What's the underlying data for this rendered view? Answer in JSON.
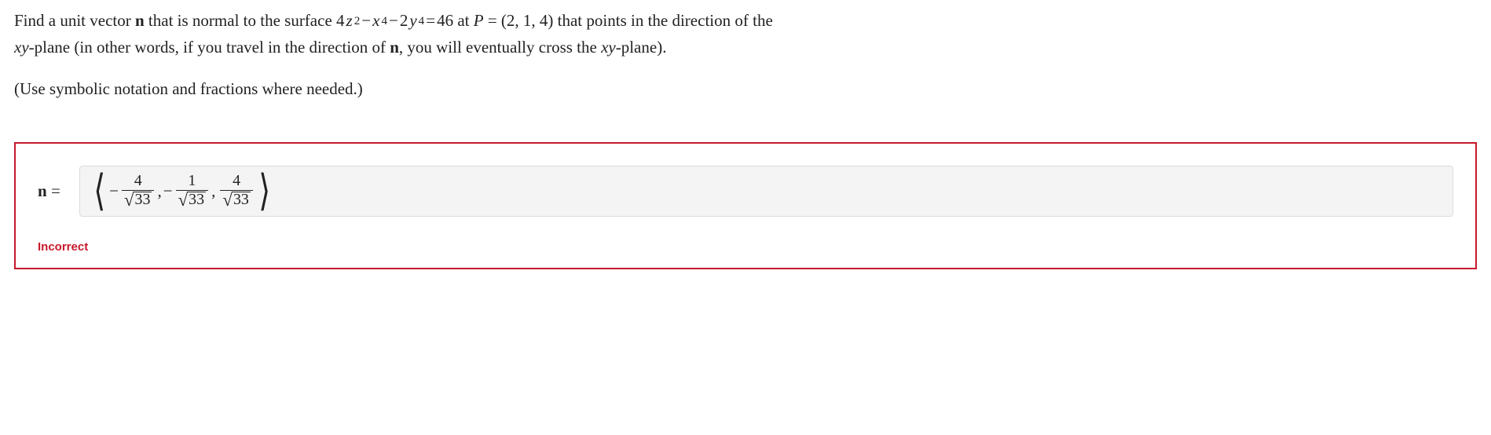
{
  "problem": {
    "line1_pre": "Find a unit vector ",
    "vector_symbol": "n",
    "line1_mid1": " that is normal to the surface ",
    "equation_lhs_parts": {
      "term1_coef": "4",
      "term1_var": "z",
      "term1_exp": "2",
      "minus1": " − ",
      "term2_var": "x",
      "term2_exp": "4",
      "minus2": " − ",
      "term3_coef": "2",
      "term3_var": "y",
      "term3_exp": "4"
    },
    "equals": " = ",
    "rhs": "46",
    "line1_mid2": " at ",
    "point_label": "P",
    "point_eq": " = ",
    "point_value": "(2, 1, 4)",
    "line1_tail": " that points in the direction of the",
    "line2_pre_var": "xy",
    "line2_mid": "-plane (in other words, if you travel in the direction of ",
    "line2_post": ", you will eventually cross the ",
    "line2_var2": "xy",
    "line2_end": "-plane).",
    "instruction": "(Use symbolic notation and fractions where needed.)"
  },
  "answer": {
    "label_symbol": "n",
    "label_eq": " =",
    "vec_open": "⟨",
    "t1": {
      "sign": "−",
      "num": "4",
      "rad": "33"
    },
    "sep1": ", ",
    "t2": {
      "sign": "−",
      "num": "1",
      "rad": "33"
    },
    "sep2": ", ",
    "t3": {
      "sign": "",
      "num": "4",
      "rad": "33"
    },
    "vec_close": "⟩"
  },
  "feedback": "Incorrect"
}
